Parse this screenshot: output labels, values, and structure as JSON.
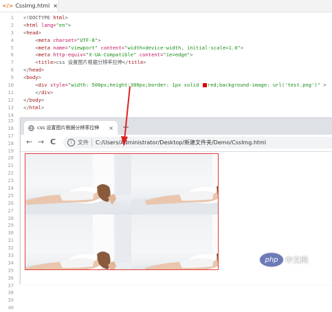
{
  "editor": {
    "tab": {
      "icon": "html-file-icon",
      "label": "CssImg.html",
      "close": "×"
    }
  },
  "code_lines": [
    {
      "num": "1",
      "tokens": [
        [
          "p",
          "<!DOCTYPE "
        ],
        [
          "t",
          "html"
        ],
        [
          "p",
          ">"
        ]
      ]
    },
    {
      "num": "2",
      "tokens": [
        [
          "p",
          "<"
        ],
        [
          "t",
          "html "
        ],
        [
          "a",
          "lang="
        ],
        [
          "s",
          "\"en\""
        ],
        [
          "p",
          ">"
        ]
      ]
    },
    {
      "num": "3",
      "tokens": [
        [
          "p",
          "<"
        ],
        [
          "t",
          "head"
        ],
        [
          "p",
          ">"
        ]
      ]
    },
    {
      "num": "4",
      "tokens": [
        [
          "p",
          "    <"
        ],
        [
          "t",
          "meta "
        ],
        [
          "a",
          "charset="
        ],
        [
          "s",
          "\"UTF-8\""
        ],
        [
          "p",
          ">"
        ]
      ]
    },
    {
      "num": "5",
      "tokens": [
        [
          "p",
          "    <"
        ],
        [
          "t",
          "meta "
        ],
        [
          "a",
          "name="
        ],
        [
          "s",
          "\"viewport\" "
        ],
        [
          "a",
          "content="
        ],
        [
          "s",
          "\"width=device-width, initial-scale=1.0\""
        ],
        [
          "p",
          ">"
        ]
      ]
    },
    {
      "num": "6",
      "tokens": [
        [
          "p",
          "    <"
        ],
        [
          "t",
          "meta "
        ],
        [
          "a",
          "http-equiv="
        ],
        [
          "s",
          "\"X-UA-Compatible\" "
        ],
        [
          "a",
          "content="
        ],
        [
          "s",
          "\"ie=edge\""
        ],
        [
          "p",
          ">"
        ]
      ]
    },
    {
      "num": "7",
      "tokens": [
        [
          "p",
          "    <"
        ],
        [
          "t",
          "title"
        ],
        [
          "p",
          ">css 设置图片根据分辨率拉伸</"
        ],
        [
          "t",
          "title"
        ],
        [
          "p",
          ">"
        ]
      ]
    },
    {
      "num": "8",
      "tokens": [
        [
          "p",
          "</"
        ],
        [
          "t",
          "head"
        ],
        [
          "p",
          ">"
        ]
      ]
    },
    {
      "num": "9",
      "tokens": [
        [
          "p",
          "<"
        ],
        [
          "t",
          "body"
        ],
        [
          "p",
          ">"
        ]
      ]
    },
    {
      "num": "10",
      "tokens": [
        [
          "p",
          "    <"
        ],
        [
          "t",
          "div "
        ],
        [
          "a",
          "style="
        ],
        [
          "s",
          "\"width: 500px;height:300px;border: 1px solid "
        ],
        [
          "swatch",
          ""
        ],
        [
          "s",
          "red;background-image: url('test.png')\""
        ],
        [
          "p",
          " >"
        ]
      ]
    },
    {
      "num": "11",
      "tokens": [
        [
          "p",
          "    </"
        ],
        [
          "t",
          "div"
        ],
        [
          "p",
          ">"
        ]
      ]
    },
    {
      "num": "12",
      "tokens": [
        [
          "p",
          "</"
        ],
        [
          "t",
          "body"
        ],
        [
          "p",
          ">"
        ]
      ]
    },
    {
      "num": "13",
      "tokens": [
        [
          "p",
          "</"
        ],
        [
          "t",
          "html"
        ],
        [
          "p",
          ">"
        ]
      ]
    },
    {
      "num": "14",
      "tokens": []
    }
  ],
  "gutter_numbers": [
    "15",
    "16",
    "17",
    "18",
    "19",
    "20",
    "21",
    "22",
    "23",
    "24",
    "25",
    "26",
    "27",
    "28",
    "29",
    "30",
    "31",
    "32",
    "33",
    "34",
    "35",
    "36",
    "37",
    "38",
    "39",
    "40"
  ],
  "browser": {
    "tab_title": "css 设置图片根据分辨率拉伸",
    "tab_close": "×",
    "new_tab": "+",
    "back": "←",
    "forward": "→",
    "reload": "C",
    "info_label": "文件",
    "url": "C:/Users/Administrator/Desktop/新建文件夹/Demo/CssImg.html"
  },
  "demo_div": {
    "border_color": "#e33a3a",
    "background": "tiled photo (test.png)"
  },
  "watermark": {
    "logo": "php",
    "text": "中文网"
  },
  "colors": {
    "arrow": "#e02020",
    "tag": "#a31515",
    "attr": "#c2185b",
    "string": "#1a8f1a"
  }
}
